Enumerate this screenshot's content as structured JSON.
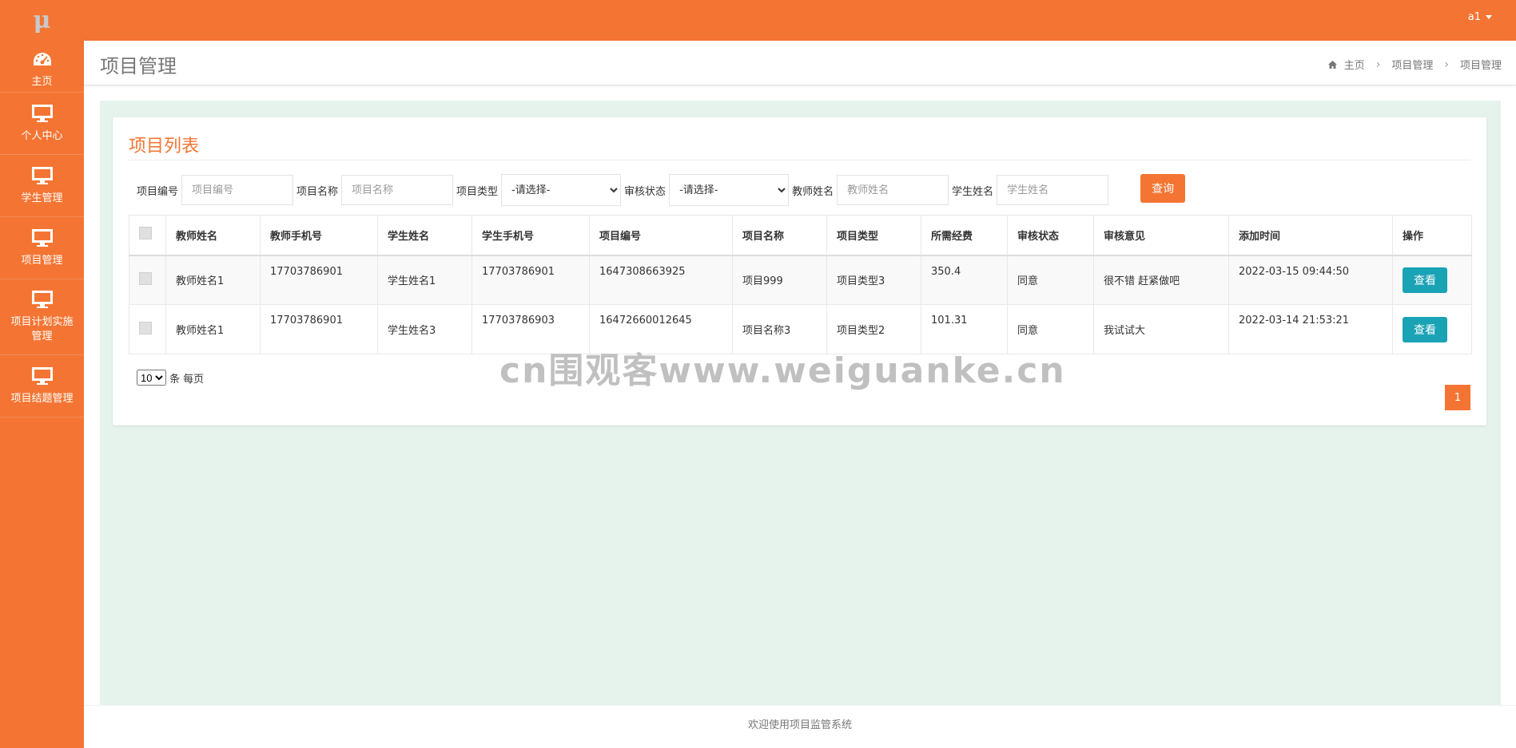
{
  "app": {
    "logo": "μ"
  },
  "user": {
    "name": "a1"
  },
  "sidebar": {
    "items": [
      {
        "label": "主页",
        "icon": "dashboard-icon"
      },
      {
        "label": "个人中心",
        "icon": "monitor-icon"
      },
      {
        "label": "学生管理",
        "icon": "monitor-icon"
      },
      {
        "label": "项目管理",
        "icon": "monitor-icon"
      },
      {
        "label": "项目计划实施管理",
        "icon": "monitor-icon"
      },
      {
        "label": "项目结题管理",
        "icon": "monitor-icon"
      }
    ]
  },
  "header": {
    "title": "项目管理",
    "breadcrumb": [
      "主页",
      "项目管理",
      "项目管理"
    ]
  },
  "box": {
    "title": "项目列表"
  },
  "search": {
    "fields": [
      {
        "label": "项目编号",
        "placeholder": "项目编号"
      },
      {
        "label": "项目名称",
        "placeholder": "项目名称"
      },
      {
        "label": "项目类型",
        "selected": "-请选择-"
      },
      {
        "label": "审核状态",
        "selected": "-请选择-"
      },
      {
        "label": "教师姓名",
        "placeholder": "教师姓名"
      },
      {
        "label": "学生姓名",
        "placeholder": "学生姓名"
      }
    ],
    "button": "查询"
  },
  "table": {
    "headers": [
      "教师姓名",
      "教师手机号",
      "学生姓名",
      "学生手机号",
      "项目编号",
      "项目名称",
      "项目类型",
      "所需经费",
      "审核状态",
      "审核意见",
      "添加时间",
      "操作"
    ],
    "rows": [
      {
        "teacher": "教师姓名1",
        "teacher_phone": "17703786901",
        "student": "学生姓名1",
        "student_phone": "17703786901",
        "project_no": "1647308663925",
        "project_name": "项目999",
        "project_type": "项目类型3",
        "fund": "350.4",
        "status": "同意",
        "opinion": "很不错 赶紧做吧",
        "added": "2022-03-15 09:44:50",
        "action": "查看"
      },
      {
        "teacher": "教师姓名1",
        "teacher_phone": "17703786901",
        "student": "学生姓名3",
        "student_phone": "17703786903",
        "project_no": "16472660012645",
        "project_name": "项目名称3",
        "project_type": "项目类型2",
        "fund": "101.31",
        "status": "同意",
        "opinion": "我试试大",
        "added": "2022-03-14 21:53:21",
        "action": "查看"
      }
    ]
  },
  "pager": {
    "size": "10",
    "size_suffix": "条 每页",
    "current": "1"
  },
  "footer": {
    "text": "欢迎使用项目监管系统"
  },
  "watermark": "cn围观客www.weiguanke.cn",
  "colors": {
    "brand": "#f47533",
    "view_button": "#1aa2b5",
    "content_bg": "#e6f3ec"
  }
}
